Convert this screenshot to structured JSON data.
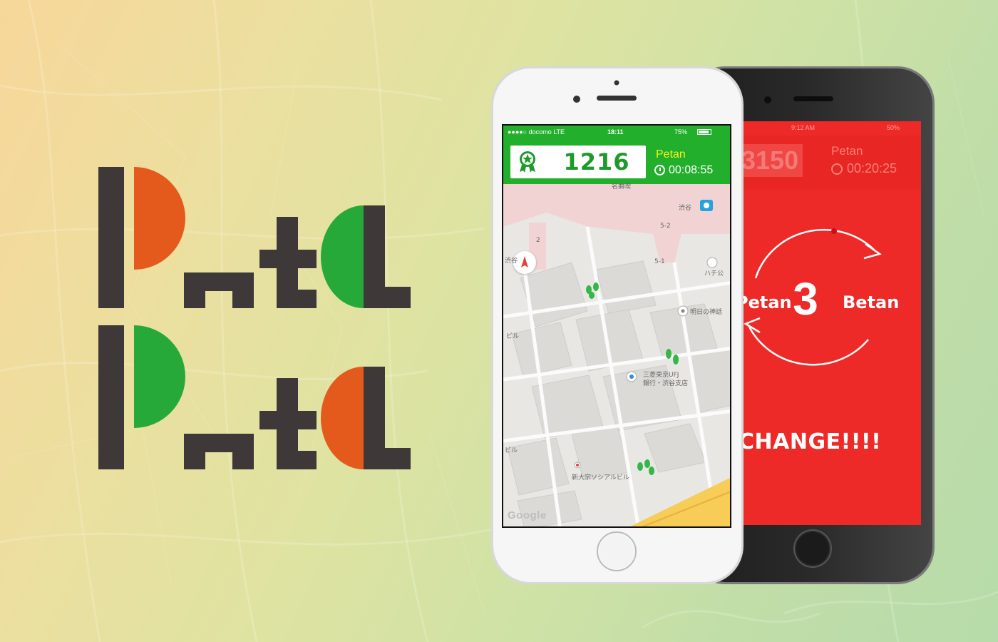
{
  "colors": {
    "dark": "#3e3838",
    "orange": "#e35a1c",
    "green": "#27a93a",
    "app_green": "#22b02c",
    "app_red": "#ee2a28",
    "timer_name": "#f4f01c"
  },
  "logo": {
    "text": "Peta Peta",
    "lines": [
      "Peta",
      "Peta"
    ]
  },
  "front_phone": {
    "status": {
      "carrier": "●●●●○ docomo  LTE",
      "time": "18:11",
      "battery": "75%"
    },
    "header": {
      "badge_icon": "award-star-icon",
      "score": "1216",
      "player_name": "Petan",
      "timer_icon": "stopwatch-icon",
      "timer": "00:08:55"
    },
    "map": {
      "labels": {
        "shibuya_station": "渋谷",
        "hachiko": "ハチ公",
        "asunokami": "明日の神話",
        "shibuya_left": "渋谷",
        "building_left": "ビル",
        "bank": "三菱東京UFJ",
        "bank_branch": "銀行・渋谷支店",
        "building_bottom": "新大宗ソシアルビル",
        "building_left2": "ビル",
        "meirin": "名曲喫",
        "area_52": "5-2",
        "area_51": "5-1",
        "area_2": "2"
      },
      "attribution": "Google"
    }
  },
  "back_phone": {
    "status": {
      "time": "9:12 AM",
      "battery": "50%"
    },
    "header": {
      "score": "3150",
      "player_name": "Petan",
      "timer": "00:20:25"
    },
    "countdown": "3",
    "left_player": "Petan",
    "right_player": "Betan",
    "message": "CHANGE!!!!"
  }
}
